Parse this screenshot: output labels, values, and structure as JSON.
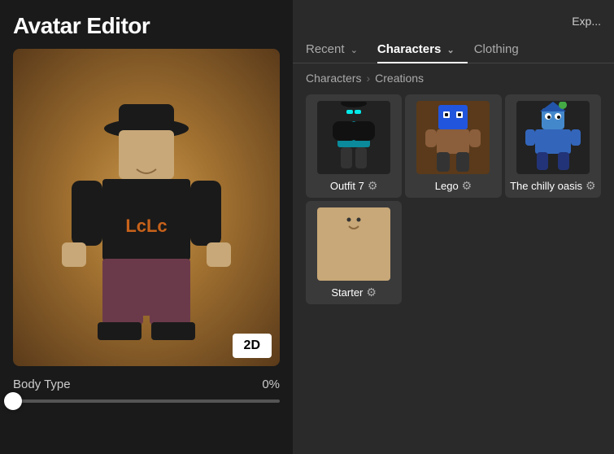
{
  "app": {
    "title": "Avatar Editor"
  },
  "topbar": {
    "explore_label": "Exp..."
  },
  "nav": {
    "tabs": [
      {
        "id": "recent",
        "label": "Recent",
        "has_chevron": true,
        "active": false
      },
      {
        "id": "characters",
        "label": "Characters",
        "has_chevron": true,
        "active": true
      },
      {
        "id": "clothing",
        "label": "Clothing",
        "has_chevron": false,
        "active": false
      }
    ]
  },
  "breadcrumb": {
    "parts": [
      "Characters",
      "Creations"
    ],
    "separator": "›"
  },
  "body_type": {
    "label": "Body Type",
    "value": "0%",
    "slider_position": 0
  },
  "button_2d": "2D",
  "grid": {
    "items": [
      {
        "id": "outfit7",
        "name": "Outfit 7",
        "has_gear": true,
        "bg": "dark"
      },
      {
        "id": "lego",
        "name": "Lego",
        "has_gear": true,
        "bg": "brown"
      },
      {
        "id": "thechillyoasis",
        "name": "The chilly oasis",
        "has_gear": true,
        "bg": "dark"
      },
      {
        "id": "starter",
        "name": "Starter",
        "has_gear": true,
        "bg": "tan"
      }
    ]
  }
}
